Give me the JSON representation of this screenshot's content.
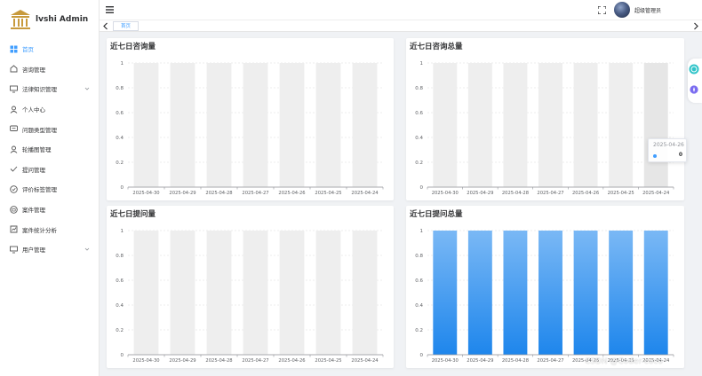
{
  "app": {
    "brand": "lvshi Admin"
  },
  "sidebar": {
    "items": [
      {
        "label": "首页",
        "icon": "dashboard-icon",
        "active": true
      },
      {
        "label": "咨询管理",
        "icon": "home-icon"
      },
      {
        "label": "法律知识管理",
        "icon": "monitor-icon",
        "expandable": true
      },
      {
        "label": "个人中心",
        "icon": "user-icon"
      },
      {
        "label": "问题类型管理",
        "icon": "chat-icon"
      },
      {
        "label": "轮播图管理",
        "icon": "user-icon"
      },
      {
        "label": "提问管理",
        "icon": "check-icon"
      },
      {
        "label": "评价标签管理",
        "icon": "tag-icon"
      },
      {
        "label": "案件管理",
        "icon": "briefcase-icon"
      },
      {
        "label": "案件统计分析",
        "icon": "chart-icon"
      },
      {
        "label": "用户管理",
        "icon": "monitor-icon",
        "expandable": true
      }
    ]
  },
  "header": {
    "username": "超级管理员"
  },
  "tabs": {
    "home": "首页"
  },
  "tooltip": {
    "date": "2025-04-26",
    "value": "0"
  },
  "watermark": "CSDN @Coder-coco",
  "colors": {
    "accent": "#409eff",
    "bar_top": "#7ab8f5",
    "bar_bottom": "#1e86ec",
    "bar_bg": "#eeeeee"
  },
  "chart_data": [
    {
      "type": "bar",
      "title": "近七日咨询量",
      "categories": [
        "2025-04-30",
        "2025-04-29",
        "2025-04-28",
        "2025-04-27",
        "2025-04-26",
        "2025-04-25",
        "2025-04-24"
      ],
      "values": [
        0,
        0,
        0,
        0,
        0,
        0,
        0
      ],
      "ylim": [
        0,
        1
      ],
      "yticks": [
        "0",
        "0.2",
        "0.4",
        "0.6",
        "0.8",
        "1"
      ],
      "background_bars": true
    },
    {
      "type": "bar",
      "title": "近七日咨询总量",
      "categories": [
        "2025-04-30",
        "2025-04-29",
        "2025-04-28",
        "2025-04-27",
        "2025-04-26",
        "2025-04-25",
        "2025-04-24"
      ],
      "values": [
        0,
        0,
        0,
        0,
        0,
        0,
        0
      ],
      "ylim": [
        0,
        1
      ],
      "yticks": [
        "0",
        "0.2",
        "0.4",
        "0.6",
        "0.8",
        "1"
      ],
      "background_bars": true,
      "highlighted_category": "2025-04-24"
    },
    {
      "type": "bar",
      "title": "近七日提问量",
      "categories": [
        "2025-04-30",
        "2025-04-29",
        "2025-04-28",
        "2025-04-27",
        "2025-04-26",
        "2025-04-25",
        "2025-04-24"
      ],
      "values": [
        0,
        0,
        0,
        0,
        0,
        0,
        0
      ],
      "ylim": [
        0,
        1
      ],
      "yticks": [
        "0",
        "0.2",
        "0.4",
        "0.6",
        "0.8",
        "1"
      ],
      "background_bars": true
    },
    {
      "type": "bar",
      "title": "近七日提问总量",
      "categories": [
        "2025-04-30",
        "2025-04-29",
        "2025-04-28",
        "2025-04-27",
        "2025-04-26",
        "2025-04-25",
        "2025-04-24"
      ],
      "values": [
        1,
        1,
        1,
        1,
        1,
        1,
        1
      ],
      "ylim": [
        0,
        1
      ],
      "yticks": [
        "0",
        "0.2",
        "0.4",
        "0.6",
        "0.8",
        "1"
      ],
      "background_bars": false
    }
  ]
}
